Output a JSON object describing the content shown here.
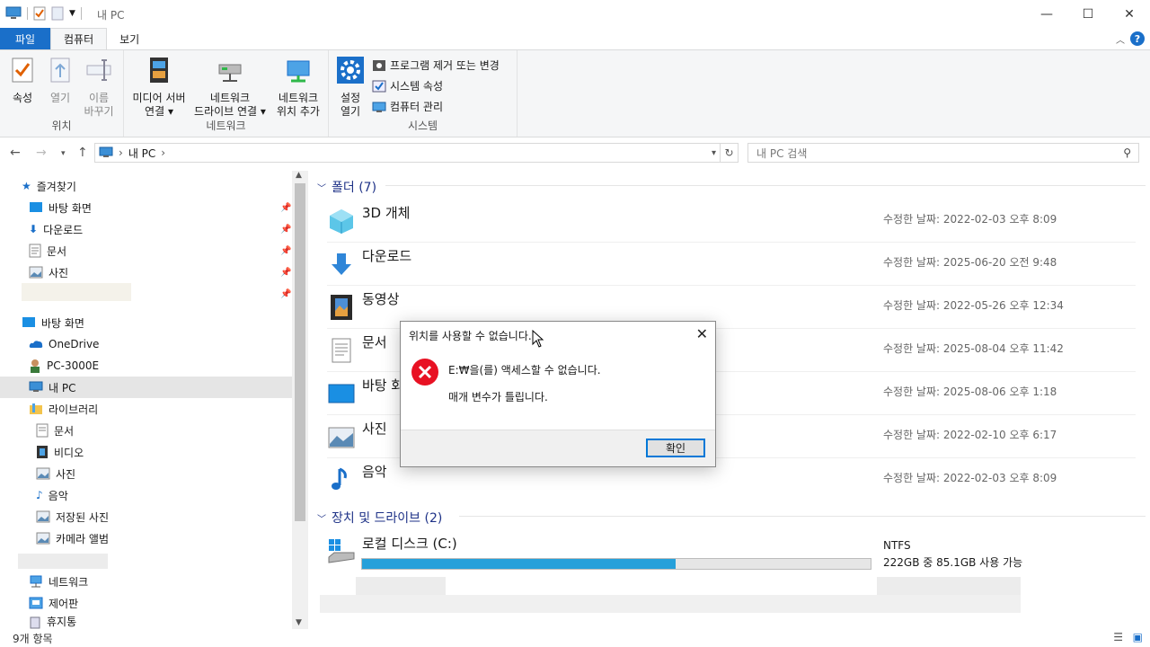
{
  "window": {
    "title": "내 PC"
  },
  "tabs": {
    "file": "파일",
    "computer": "컴퓨터",
    "view": "보기"
  },
  "ribbon": {
    "location": {
      "label": "위치",
      "properties": "속성",
      "open": "열기",
      "rename_1": "이름",
      "rename_2": "바꾸기"
    },
    "network": {
      "label": "네트워크",
      "media_1": "미디어 서버",
      "media_2": "연결",
      "map_1": "네트워크",
      "map_2": "드라이브 연결",
      "add_1": "네트워크",
      "add_2": "위치 추가"
    },
    "system": {
      "label": "시스템",
      "settings_1": "설정",
      "settings_2": "열기",
      "uninstall": "프로그램 제거 또는 변경",
      "sysprops": "시스템 속성",
      "manage": "컴퓨터 관리"
    }
  },
  "address": {
    "path": "내 PC",
    "search_placeholder": "내 PC 검색"
  },
  "nav": {
    "quick_access": "즐겨찾기",
    "items": [
      "바탕 화면",
      "다운로드",
      "문서",
      "사진"
    ],
    "desktop": "바탕 화면",
    "onedrive": "OneDrive",
    "user": "PC-3000E",
    "thispc": "내 PC",
    "libraries": "라이브러리",
    "lib_items": [
      "문서",
      "비디오",
      "사진",
      "음악",
      "저장된 사진",
      "카메라 앨범"
    ],
    "network": "네트워크",
    "control": "제어판",
    "recycle": "휴지통"
  },
  "folders": {
    "header": "폴더 (7)",
    "date_label": "수정한 날짜:",
    "items": [
      {
        "name": "3D 개체",
        "date": "2022-02-03 오후 8:09"
      },
      {
        "name": "다운로드",
        "date": "2025-06-20 오전 9:48"
      },
      {
        "name": "동영상",
        "date": "2022-05-26 오후 12:34"
      },
      {
        "name": "문서",
        "date": "2025-08-04 오후 11:42"
      },
      {
        "name": "바탕 화면",
        "date": "2025-08-06 오후 1:18"
      },
      {
        "name": "사진",
        "date": "2022-02-10 오후 6:17"
      },
      {
        "name": "음악",
        "date": "2022-02-03 오후 8:09"
      }
    ]
  },
  "drives": {
    "header": "장치 및 드라이브 (2)",
    "c": {
      "name": "로컬 디스크 (C:)",
      "fs": "NTFS",
      "space": "222GB 중 85.1GB 사용 가능",
      "used_fraction": 0.617
    }
  },
  "status": {
    "count": "9개 항목"
  },
  "dialog": {
    "title": "위치를 사용할 수 없습니다.",
    "message1": "E:₩을(를) 액세스할 수 없습니다.",
    "message2": "매개 변수가 틀립니다.",
    "ok": "확인"
  }
}
